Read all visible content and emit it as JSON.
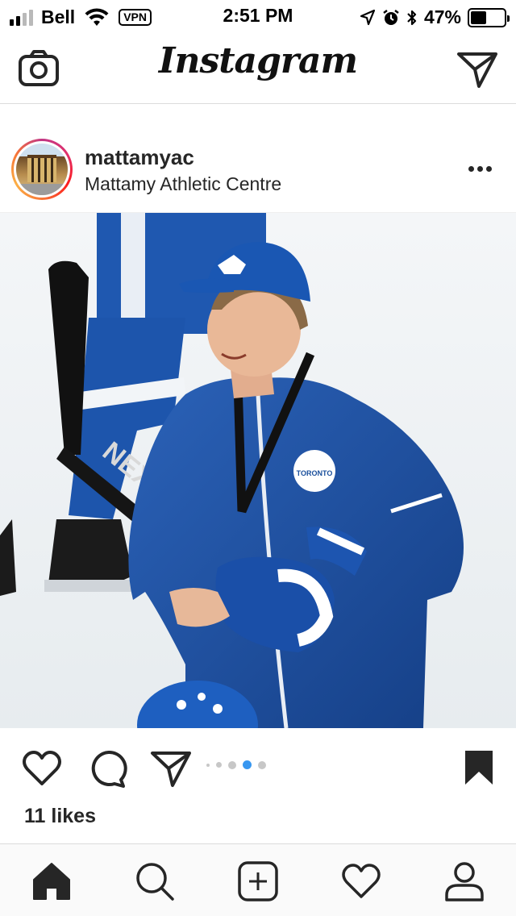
{
  "status_bar": {
    "carrier": "Bell",
    "vpn": "VPN",
    "time": "2:51 PM",
    "battery_percent": "47%",
    "battery_level": 0.47,
    "signal_bars_filled": 2,
    "signal_bars_total": 4
  },
  "nav": {
    "logo": "Instagram",
    "camera_icon": "camera-icon",
    "direct_icon": "paper-plane-icon"
  },
  "post": {
    "username": "mattamyac",
    "location": "Mattamy Athletic Centre",
    "more_icon": "more-horizontal-icon",
    "photo_description_icon": "hockey-coach-photo",
    "likes": "11 likes",
    "carousel": {
      "total": 5,
      "active": 3
    },
    "actions": {
      "like_icon": "heart-icon",
      "comment_icon": "comment-bubble-icon",
      "share_icon": "paper-plane-icon",
      "save_icon": "bookmark-filled-icon"
    }
  },
  "tab_bar": {
    "items": [
      {
        "name": "home",
        "icon": "home-filled-icon",
        "active": true
      },
      {
        "name": "search",
        "icon": "search-icon",
        "active": false
      },
      {
        "name": "add",
        "icon": "plus-square-icon",
        "active": false
      },
      {
        "name": "activity",
        "icon": "heart-icon",
        "active": false
      },
      {
        "name": "profile",
        "icon": "user-icon",
        "active": false
      }
    ]
  },
  "colors": {
    "accent_blue": "#3897f0",
    "leafs_blue": "#1a4f9c",
    "text": "#262626",
    "divider": "#dbdbdb"
  }
}
